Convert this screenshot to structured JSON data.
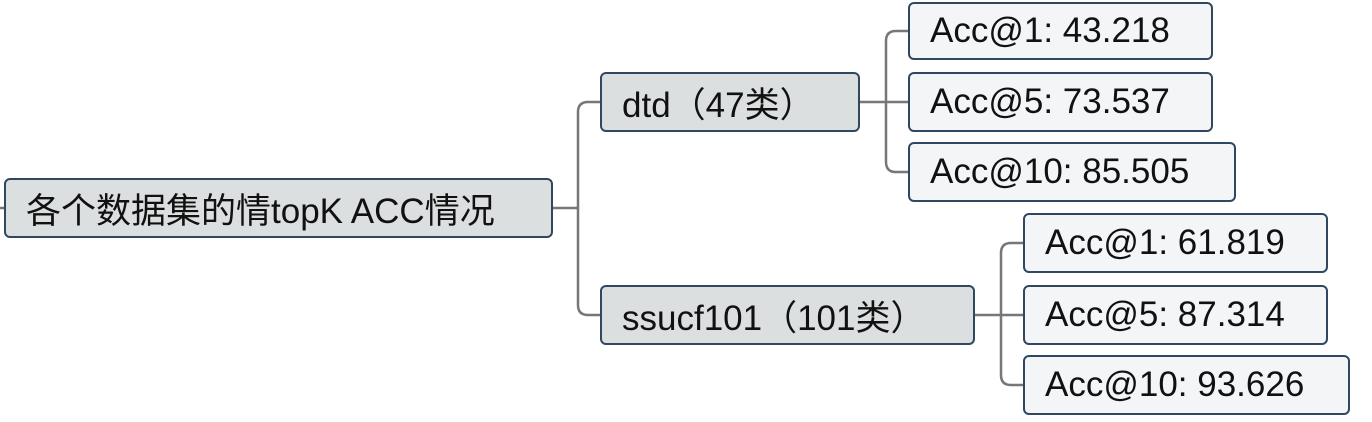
{
  "root": {
    "label": "各个数据集的情topK ACC情况"
  },
  "branches": [
    {
      "label": "dtd（47类）",
      "leaves": [
        "Acc@1: 43.218",
        "Acc@5: 73.537",
        "Acc@10: 85.505"
      ]
    },
    {
      "label": "ssucf101（101类）",
      "leaves": [
        "Acc@1: 61.819",
        "Acc@5: 87.314",
        "Acc@10: 93.626"
      ]
    }
  ],
  "colors": {
    "border": "#2f4760",
    "main_fill": "#dcdfe0",
    "leaf_fill": "#f3f5f7",
    "connector": "#777777"
  }
}
